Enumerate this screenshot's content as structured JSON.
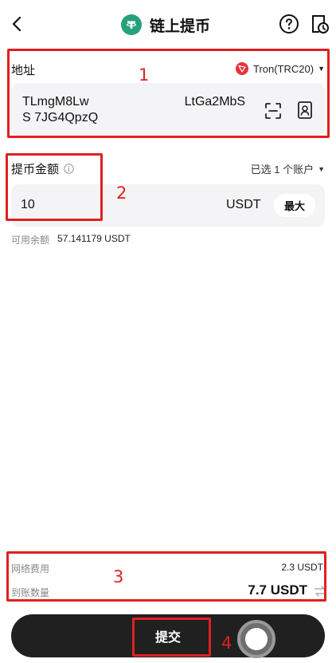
{
  "header": {
    "title": "链上提币"
  },
  "address": {
    "label": "地址",
    "network": "Tron(TRC20)",
    "value": "TLmgM8Lw                           LtGa2MbSS 7JG4QpzQ"
  },
  "amount": {
    "label": "提币金额",
    "account_select": "已选 1 个账户",
    "value": "10",
    "unit": "USDT",
    "max_label": "最大"
  },
  "available": {
    "label": "可用余额",
    "value": "57.141179 USDT"
  },
  "summary": {
    "fee_label": "网络费用",
    "fee_value": "2.3 USDT",
    "receive_label": "到账数量",
    "receive_value": "7.7 USDT"
  },
  "submit_label": "提交",
  "annotations": [
    "1",
    "2",
    "3",
    "4"
  ],
  "colors": {
    "annotation": "#e02020",
    "tether": "#26a17b",
    "tron": "#e8313a",
    "button": "#202020"
  }
}
